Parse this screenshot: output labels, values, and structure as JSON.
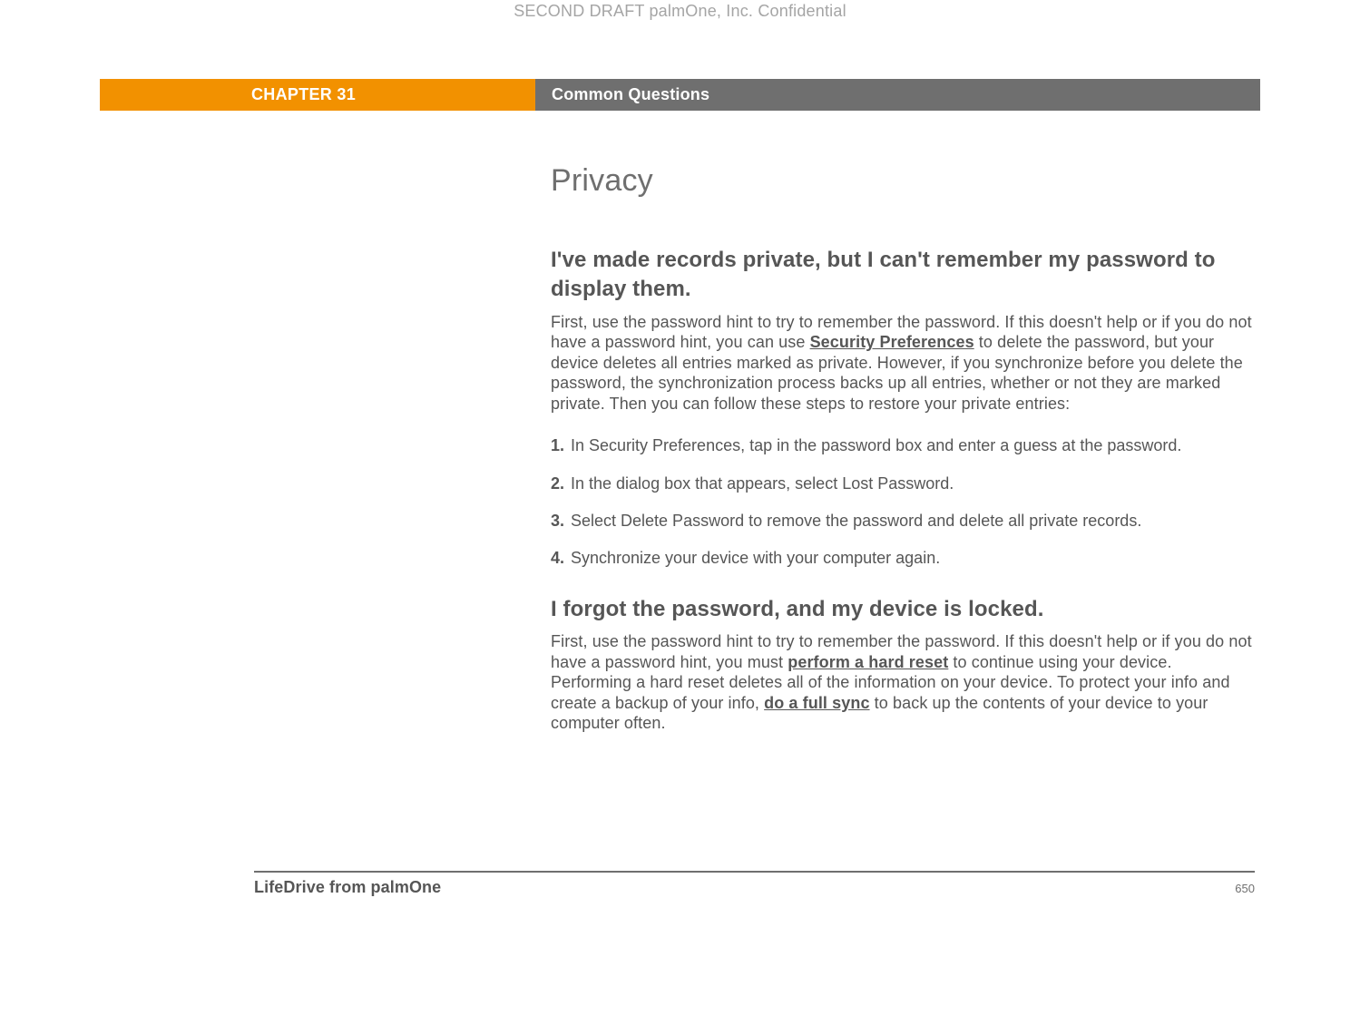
{
  "draft_header": "SECOND DRAFT palmOne, Inc.  Confidential",
  "chapter_label": "CHAPTER 31",
  "chapter_title": "Common Questions",
  "section_title": "Privacy",
  "q1": {
    "heading": "I've made records private, but I can't remember my password to display them.",
    "para_before_link": "First, use the password hint to try to remember the password. If this doesn't help or if you do not have a password hint, you can use ",
    "link": "Security Preferences",
    "para_after_link": " to delete the password, but your device deletes all entries marked as private. However, if you synchronize before you delete the password, the synchronization process backs up all entries, whether or not they are marked private. Then you can follow these steps to restore your private entries:",
    "steps": [
      "In Security Preferences, tap in the password box and enter a guess at the password.",
      "In the dialog box that appears, select Lost Password.",
      "Select Delete Password to remove the password and delete all private records.",
      "Synchronize your device with your computer again."
    ]
  },
  "q2": {
    "heading": "I forgot the password, and my device is locked.",
    "t1": "First, use the password hint to try to remember the password. If this doesn't help or if you do not have a password hint, you must ",
    "link1": "perform a hard reset",
    "t2": " to continue using your device. Performing a hard reset deletes all of the information on your device. To protect your info and create a backup of your info, ",
    "link2": "do a full sync",
    "t3": " to back up the contents of your device to your computer often."
  },
  "footer": {
    "title": "LifeDrive from palmOne",
    "page": "650"
  }
}
